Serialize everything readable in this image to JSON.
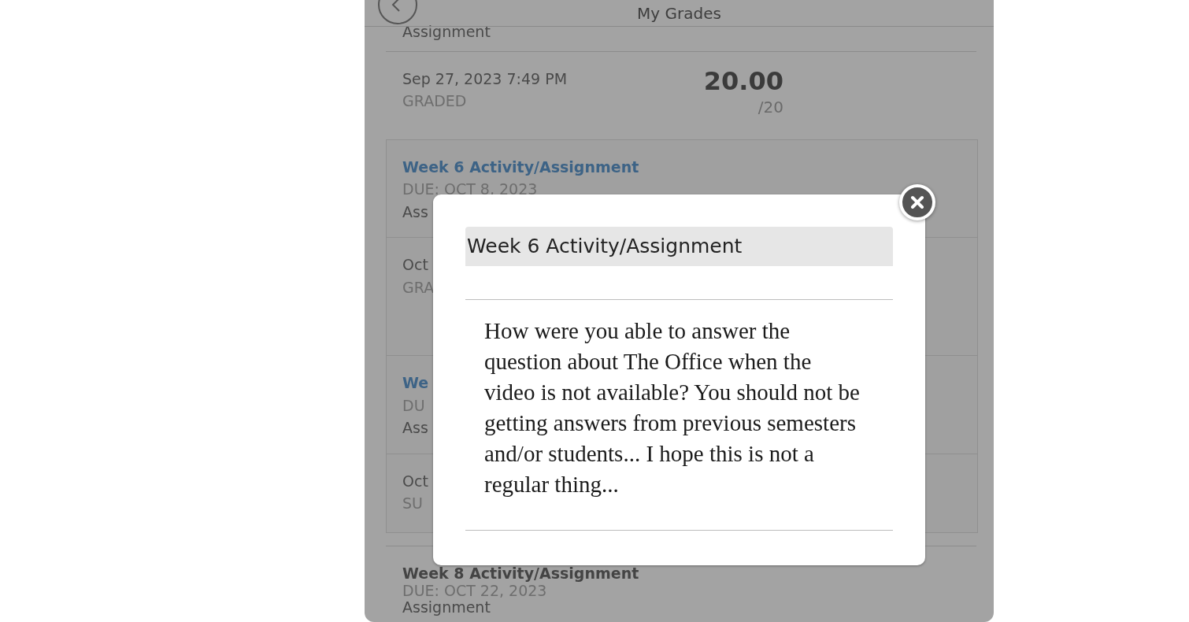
{
  "header": {
    "title": "My Grades"
  },
  "top_item": {
    "type_label": "Assignment",
    "attempts": [
      {
        "date": "Sep 27, 2023 7:49 PM",
        "status": "GRADED",
        "score": "20.00",
        "out_of": "/20"
      }
    ]
  },
  "card_items": [
    {
      "title": "Week 6 Activity/Assignment",
      "linked": true,
      "due": "DUE: OCT 8, 2023",
      "type_label": "Ass",
      "attempts": [
        {
          "date": "Oct",
          "status": "GRA"
        }
      ]
    },
    {
      "title": "We",
      "linked": true,
      "due": "DU",
      "type_label": "Ass",
      "attempts": [
        {
          "date": "Oct",
          "status": "SU"
        }
      ]
    }
  ],
  "bottom_items": [
    {
      "title": "Week 8 Activity/Assignment",
      "linked": false,
      "due": "DUE: OCT 22, 2023",
      "type_label": "Assignment"
    }
  ],
  "modal": {
    "title": "Week 6 Activity/Assignment",
    "body": "How were you able to answer the question about The Office when the video is not available? You should not be getting answers from previous semesters and/or students... I hope this is not a regular thing..."
  }
}
